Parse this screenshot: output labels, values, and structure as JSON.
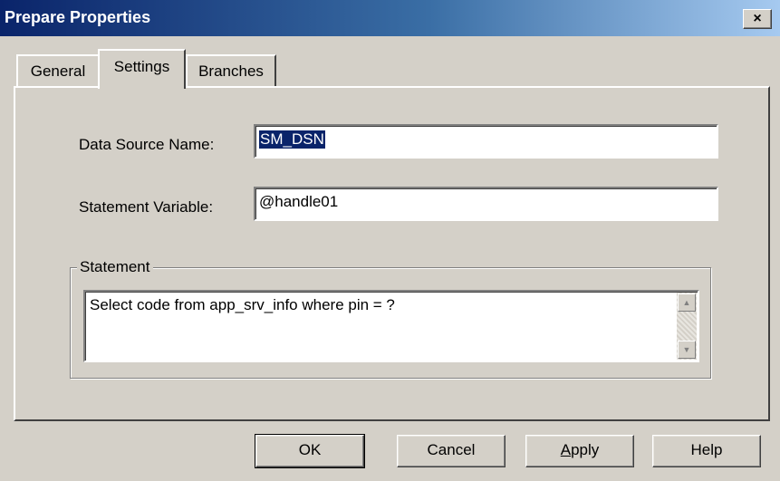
{
  "window": {
    "title": "Prepare Properties",
    "close_glyph": "×"
  },
  "tabs": [
    {
      "label": "General",
      "active": false
    },
    {
      "label": "Settings",
      "active": true
    },
    {
      "label": "Branches",
      "active": false
    }
  ],
  "settings": {
    "dsn_label": "Data Source Name:",
    "dsn_value": "SM_DSN",
    "stmt_var_label": "Statement Variable:",
    "stmt_var_value": "@handle01",
    "statement_group_label": "Statement",
    "statement_text": "Select code from app_srv_info where pin = ?"
  },
  "buttons": {
    "ok": "OK",
    "cancel": "Cancel",
    "apply_first": "A",
    "apply_rest": "pply",
    "help": "Help"
  },
  "icons": {
    "scroll_up": "scroll-up-arrow-icon",
    "scroll_down": "scroll-down-arrow-icon",
    "close": "close-icon"
  }
}
